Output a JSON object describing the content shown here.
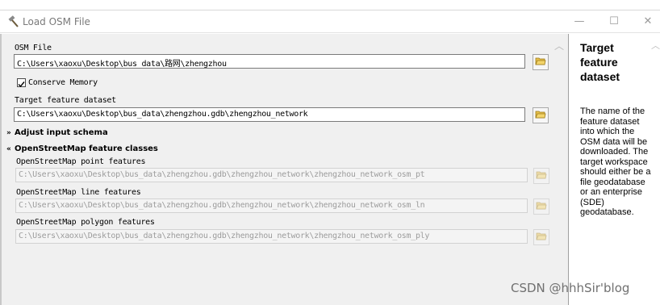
{
  "window": {
    "title": "Load OSM File",
    "minimize_glyph": "—",
    "maximize_glyph": "☐",
    "close_glyph": "✕"
  },
  "form": {
    "osm_file": {
      "label": "OSM File",
      "value": "C:\\Users\\xaoxu\\Desktop\\bus_data\\路网\\zhengzhou"
    },
    "conserve_memory": {
      "label": "Conserve Memory",
      "checked": true
    },
    "target_dataset": {
      "label": "Target feature dataset",
      "value": "C:\\Users\\xaoxu\\Desktop\\bus_data\\zhengzhou.gdb\\zhengzhou_network"
    },
    "sections": {
      "adjust_schema": "Adjust input schema",
      "feature_classes": "OpenStreetMap feature classes"
    },
    "point_features": {
      "label": "OpenStreetMap point features",
      "value": "C:\\Users\\xaoxu\\Desktop\\bus_data\\zhengzhou.gdb\\zhengzhou_network\\zhengzhou_network_osm_pt"
    },
    "line_features": {
      "label": "OpenStreetMap line features",
      "value": "C:\\Users\\xaoxu\\Desktop\\bus_data\\zhengzhou.gdb\\zhengzhou_network\\zhengzhou_network_osm_ln"
    },
    "polygon_features": {
      "label": "OpenStreetMap polygon features",
      "value": "C:\\Users\\xaoxu\\Desktop\\bus_data\\zhengzhou.gdb\\zhengzhou_network\\zhengzhou_network_osm_ply"
    }
  },
  "help": {
    "title": "Target feature dataset",
    "body": "The name of the feature dataset into which the OSM data will be downloaded. The target workspace should either be a file geodatabase or an enterprise (SDE) geodatabase."
  },
  "watermark": "CSDN @hhhSir'blog",
  "icons": {
    "title": "hammer-icon",
    "browse": "folder-open-icon",
    "expand": "chevron-double-down-icon",
    "collapse": "chevron-double-up-icon",
    "scroll_up": "chevron-up-icon"
  },
  "colors": {
    "pane_background": "#f0f0f0",
    "folder_yellow": "#e8c14a",
    "disabled_text": "#9c9c9c"
  }
}
